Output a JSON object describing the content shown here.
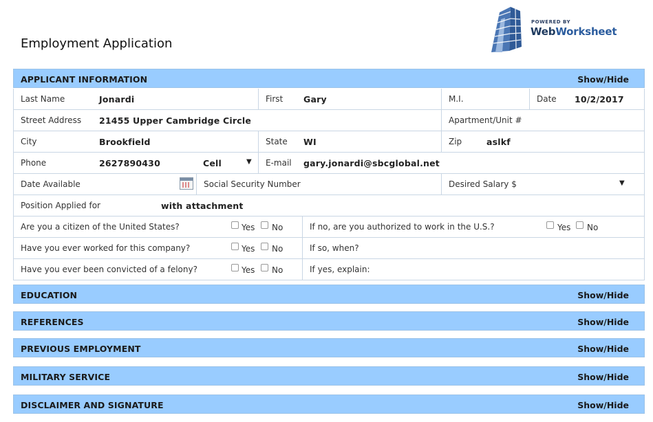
{
  "header": {
    "title": "Employment Application",
    "logo_powered": "POWERED BY",
    "logo_brand_1": "Web",
    "logo_brand_2": "Worksheet"
  },
  "toggle_label": "Show/Hide",
  "sections": {
    "applicant": "APPLICANT INFORMATION",
    "education": "EDUCATION",
    "references": "REFERENCES",
    "previous": "PREVIOUS EMPLOYMENT",
    "military": "MILITARY SERVICE",
    "disclaimer": "DISCLAIMER AND SIGNATURE"
  },
  "labels": {
    "last_name": "Last Name",
    "first": "First",
    "mi": "M.I.",
    "date": "Date",
    "street": "Street Address",
    "apartment": "Apartment/Unit #",
    "city": "City",
    "state": "State",
    "zip": "Zip",
    "phone": "Phone",
    "email": "E-mail",
    "date_available": "Date Available",
    "ssn": "Social Security Number",
    "salary": "Desired Salary $",
    "position": "Position Applied for",
    "yes": "Yes",
    "no": "No"
  },
  "values": {
    "last_name": "Jonardi",
    "first": "Gary",
    "mi": "",
    "date": "10/2/2017",
    "street": "21455 Upper Cambridge Circle",
    "apartment": "",
    "city": "Brookfield",
    "state": "WI",
    "zip": "aslkf",
    "phone": "2627890430",
    "phone_type": "Cell",
    "email": "gary.jonardi@sbcglobal.net",
    "date_available": "",
    "ssn": "",
    "salary": "",
    "position": "with attachment"
  },
  "questions": {
    "citizen": "Are you a citizen of the United States?",
    "authorized": "If no, are you authorized to work in the U.S.?",
    "worked": "Have you ever worked for this company?",
    "when": "If so, when?",
    "felony": "Have you ever been convicted of a felony?",
    "explain": "If yes, explain:"
  },
  "icons": {
    "dropdown": "▼"
  }
}
